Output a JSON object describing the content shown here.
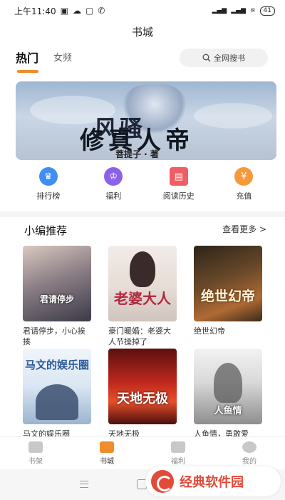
{
  "status": {
    "time": "上午11:40",
    "battery": "41"
  },
  "header": {
    "title": "书城"
  },
  "tabs": {
    "hot": "热门",
    "female": "女频"
  },
  "search": {
    "label": "全网搜书"
  },
  "banner": {
    "title_line1": "风骚",
    "title_line2": "修真人帝",
    "author": "菩提子 · 著"
  },
  "quick_links": [
    {
      "label": "排行榜",
      "color": "#3f8ef0"
    },
    {
      "label": "福利",
      "color": "#8c61e8"
    },
    {
      "label": "阅读历史",
      "color": "#ef5e64"
    },
    {
      "label": "充值",
      "color": "#f59a3c"
    }
  ],
  "recommend": {
    "title": "小编推荐",
    "more": "查看更多 >",
    "books": [
      {
        "title": "君请停步，小心挨揍",
        "cover_text": "君请停步"
      },
      {
        "title": "豪门暖婚：老婆大人节操掉了",
        "cover_text": "老婆大人"
      },
      {
        "title": "绝世幻帝",
        "cover_text": "绝世幻帝"
      },
      {
        "title": "马文的娱乐圈",
        "cover_text": "马文的娱乐圈"
      },
      {
        "title": "天地无极",
        "cover_text": "天地无极"
      },
      {
        "title": "人鱼情，勇敢爱",
        "cover_text": "人鱼情"
      }
    ]
  },
  "bottom_tabs": [
    {
      "label": "书架"
    },
    {
      "label": "书城"
    },
    {
      "label": "福利"
    },
    {
      "label": "我的"
    }
  ],
  "watermark": {
    "text": "经典软件园"
  }
}
